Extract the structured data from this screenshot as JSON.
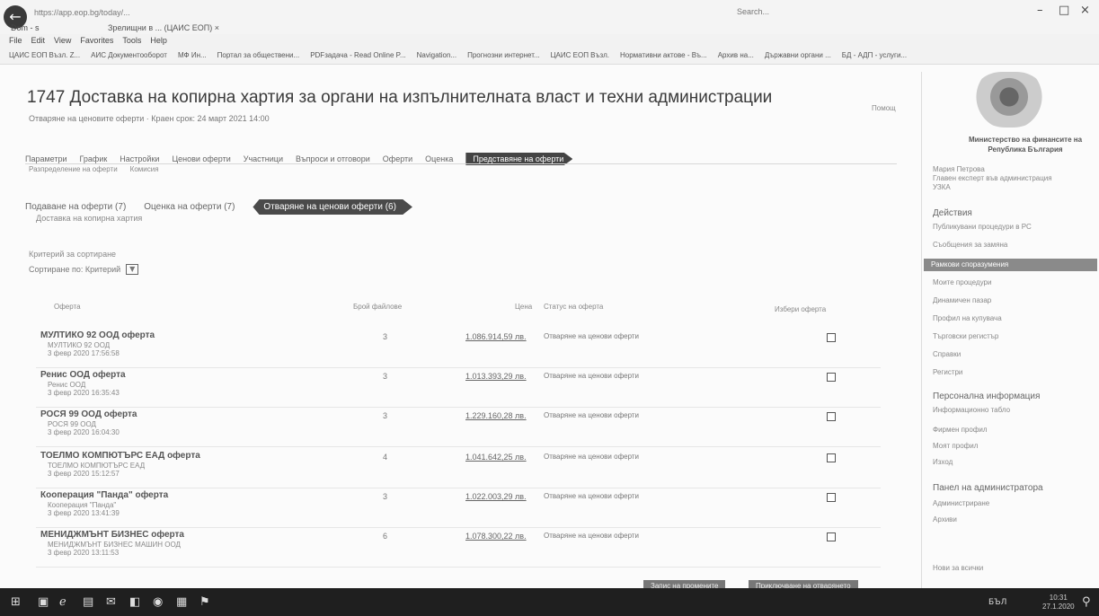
{
  "browser": {
    "url": "https://app.eop.bg/today/...",
    "tab_left": "Dom - s",
    "tab_title": "Зрелищни в ... (ЦАИС ЕОП) ×",
    "search": "Search...",
    "menu": [
      "File",
      "Edit",
      "View",
      "Favorites",
      "Tools",
      "Help"
    ],
    "favorites": [
      "ЦАИС ЕОП Възл. Z...",
      "АИС Документооборот",
      "МФ Ин...",
      "Портал за обществени...",
      "PDFзадача - Read Online P...",
      "Navigation...",
      "Прогнозни интернет...",
      "ЦАИС ЕОП Възл.",
      "Нормативни актове - Въ...",
      "Архив на...",
      "Държавни органи ...",
      "БД - АДП - услуги..."
    ]
  },
  "page": {
    "title": "1747 Доставка на копирна хартия за органи на изпълнителната власт и техни администрации",
    "subtitle": "Отварянe на ценовите оферти  ·  Краен срок: 24 март 2021 14:00",
    "right_link": "Помощ"
  },
  "tabs": [
    "Параметри",
    "График",
    "Настройки",
    "Ценови оферти",
    "Участници",
    "Въпроси и отговори",
    "Оферти",
    "Оценка"
  ],
  "active_tab": "Представяне на оферти",
  "subtabs": [
    "Разпределение на оферти",
    "Комисия"
  ],
  "phases": [
    "Подаване на оферти (7)",
    "Оценка на оферти (7)"
  ],
  "active_phase": "Отваряне на ценови оферти (6)",
  "phase_sub": "Доставка на копирна хартия",
  "filter": {
    "label": "Критерий за сортиране",
    "value": "Сортиране по: Критерий"
  },
  "table_headers": {
    "offer": "Оферта",
    "count": "Брой файлове",
    "price": "Цена",
    "status": "Статус на оферта",
    "select": "Избери оферта"
  },
  "rows": [
    {
      "name": "МУЛТИКО 92 ООД оферта",
      "company": "МУЛТИКО 92 ООД",
      "date": "3 февр 2020 17:56:58",
      "count": "3",
      "price": "1.086.914,59 лв.",
      "status": "Отваряне на ценови оферти"
    },
    {
      "name": "Ренис ООД оферта",
      "company": "Ренис ООД",
      "date": "3 февр 2020 16:35:43",
      "count": "3",
      "price": "1.013.393,29 лв.",
      "status": "Отваряне на ценови оферти"
    },
    {
      "name": "РОСЯ 99 ООД оферта",
      "company": "РОСЯ 99 ООД",
      "date": "3 февр 2020 16:04:30",
      "count": "3",
      "price": "1.229.160,28 лв.",
      "status": "Отваряне на ценови оферти"
    },
    {
      "name": "ТОЕЛМО КОМПЮТЪРС ЕАД оферта",
      "company": "ТОЕЛМО КОМПЮТЪРС ЕАД",
      "date": "3 февр 2020 15:12:57",
      "count": "4",
      "price": "1.041.642,25 лв.",
      "status": "Отваряне на ценови оферти"
    },
    {
      "name": "Кооперация \"Панда\" оферта",
      "company": "Кооперация \"Панда\"",
      "date": "3 февр 2020 13:41:39",
      "count": "3",
      "price": "1.022.003,29 лв.",
      "status": "Отваряне на ценови оферти"
    },
    {
      "name": "МЕНИДЖМЪНТ БИЗНЕС оферта",
      "company": "МЕНИДЖМЪНТ БИЗНЕС МАШИН ООД",
      "date": "3 февр 2020 13:11:53",
      "count": "6",
      "price": "1.078.300,22 лв.",
      "status": "Отваряне на ценови оферти"
    }
  ],
  "bottom_buttons": [
    "Запис на промените",
    "Приключване на отварянето"
  ],
  "sidebar": {
    "ministry": "Министерство на финансите на Република България",
    "user_lines": [
      "Мария Петрова",
      "Главен експерт във администрация",
      "УЗКА"
    ],
    "actions_head": "Действия",
    "items_a": [
      "Публикувани процедури в РС",
      "Съобщения за замяна"
    ],
    "active_item": "Рамкови споразумения",
    "items_b": [
      "Моите процедури",
      "Динамичен пазар",
      "Профил на купувача",
      "Търговски регистър",
      "Справки",
      "Регистри"
    ],
    "info_head": "Персонална информация",
    "info_items": [
      "Информационно табло",
      "Фирмен профил",
      "Моят профил",
      "Изход"
    ],
    "admin_head": "Панел на администратора",
    "admin_items": [
      "Администриране",
      "Архиви"
    ],
    "footer": "Нови за всички"
  },
  "taskbar": {
    "time": "10:31",
    "date": "27.1.2020",
    "lang": "БЪЛ"
  }
}
